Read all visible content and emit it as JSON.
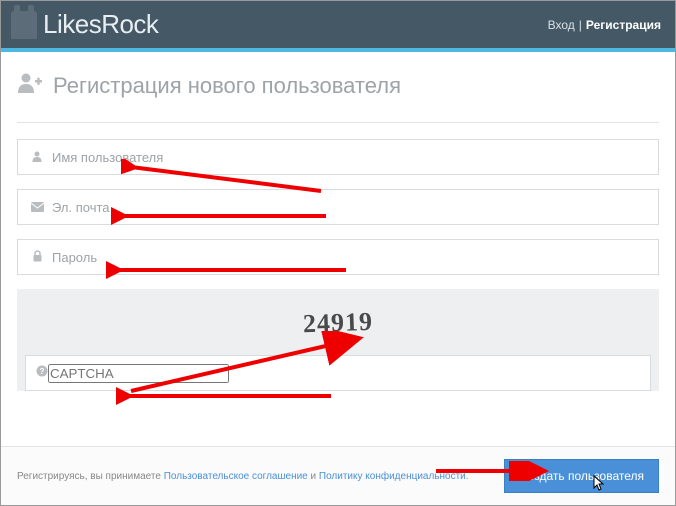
{
  "brand": "LikesRock",
  "nav": {
    "login": "Вход",
    "sep": "|",
    "register": "Регистрация"
  },
  "page_title": "Регистрация нового пользователя",
  "fields": {
    "username_placeholder": "Имя пользователя",
    "email_placeholder": "Эл. почта",
    "password_placeholder": "Пароль",
    "captcha_placeholder": "CAPTCHA"
  },
  "captcha_value": "24919",
  "terms": {
    "prefix": "Регистрируясь, вы принимаете ",
    "link1": "Пользовательское соглашение",
    "mid": " и ",
    "link2": "Политику конфиденциальности",
    "suffix": "."
  },
  "submit_label": "Создать пользователя"
}
